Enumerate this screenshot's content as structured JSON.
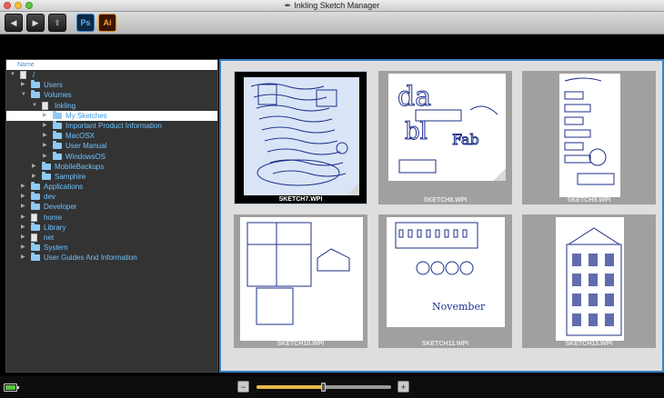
{
  "window": {
    "title": "Inkling Sketch Manager"
  },
  "toolbar": {
    "buttons": [
      {
        "name": "back-button",
        "icon": "chevron-left-icon",
        "glyph": "◀"
      },
      {
        "name": "forward-button",
        "icon": "chevron-right-icon",
        "glyph": "▶"
      },
      {
        "name": "export-button",
        "icon": "export-icon",
        "glyph": "⇪"
      },
      {
        "name": "photoshop-button",
        "icon": "photoshop-icon",
        "label": "Ps"
      },
      {
        "name": "illustrator-button",
        "icon": "illustrator-icon",
        "label": "Ai"
      }
    ]
  },
  "sidebar": {
    "header": "Name",
    "items": [
      {
        "label": "/",
        "level": 0,
        "expanded": true,
        "kind": "drive"
      },
      {
        "label": "Users",
        "level": 1,
        "expanded": false,
        "kind": "folder"
      },
      {
        "label": "Volumes",
        "level": 1,
        "expanded": true,
        "kind": "folder"
      },
      {
        "label": "Inkling",
        "level": 2,
        "expanded": true,
        "kind": "doc"
      },
      {
        "label": "My Sketches",
        "level": 3,
        "expanded": false,
        "kind": "folder",
        "selected": true
      },
      {
        "label": "Important Product Information",
        "level": 3,
        "expanded": false,
        "kind": "folder"
      },
      {
        "label": "MacOSX",
        "level": 3,
        "expanded": false,
        "kind": "folder"
      },
      {
        "label": "User Manual",
        "level": 3,
        "expanded": false,
        "kind": "folder"
      },
      {
        "label": "WindowsOS",
        "level": 3,
        "expanded": false,
        "kind": "folder"
      },
      {
        "label": "MobileBackups",
        "level": 2,
        "expanded": false,
        "kind": "folder"
      },
      {
        "label": "Samphire",
        "level": 2,
        "expanded": false,
        "kind": "folder"
      },
      {
        "label": "Applications",
        "level": 1,
        "expanded": false,
        "kind": "folder"
      },
      {
        "label": "dev",
        "level": 1,
        "expanded": false,
        "kind": "folder"
      },
      {
        "label": "Developer",
        "level": 1,
        "expanded": false,
        "kind": "folder"
      },
      {
        "label": "home",
        "level": 1,
        "expanded": false,
        "kind": "doc"
      },
      {
        "label": "Library",
        "level": 1,
        "expanded": false,
        "kind": "folder"
      },
      {
        "label": "net",
        "level": 1,
        "expanded": false,
        "kind": "doc"
      },
      {
        "label": "System",
        "level": 1,
        "expanded": false,
        "kind": "folder"
      },
      {
        "label": "User Guides And Information",
        "level": 1,
        "expanded": false,
        "kind": "folder"
      }
    ]
  },
  "sketches": [
    {
      "caption": "SKETCH7.WPI",
      "selected": true,
      "style": "blue-notes"
    },
    {
      "caption": "SKETCH8.WPI",
      "selected": false,
      "style": "letters"
    },
    {
      "caption": "SKETCH9.WPI",
      "selected": false,
      "style": "tall-boxes"
    },
    {
      "caption": "SKETCH10.WPI",
      "selected": false,
      "style": "floorplan"
    },
    {
      "caption": "SKETCH11.WPI",
      "selected": false,
      "style": "landscape"
    },
    {
      "caption": "SKETCH13.WPI",
      "selected": false,
      "style": "building"
    }
  ],
  "statusbar": {
    "battery_icon": "battery-icon",
    "zoom_out_icon": "zoom-out-icon",
    "zoom_in_icon": "zoom-in-icon",
    "zoom_level": 0.5
  },
  "colors": {
    "accent": "#3a80c4",
    "tree_text": "#6fc3ff",
    "ink": "#1c2f8a"
  }
}
